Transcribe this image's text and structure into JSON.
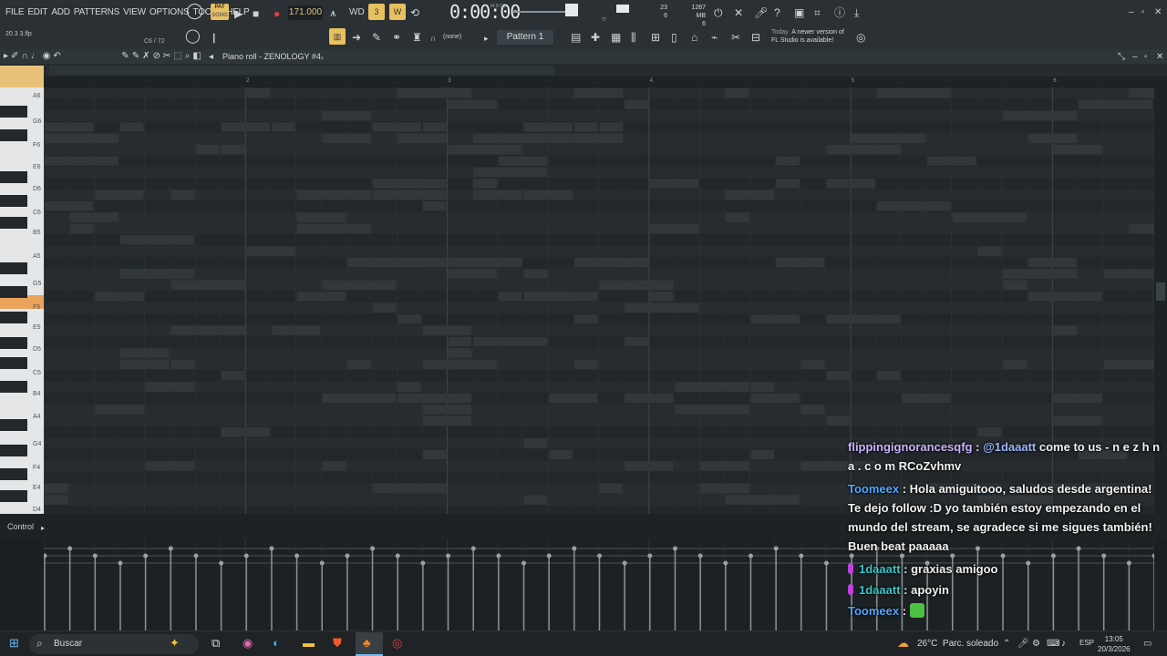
{
  "menu": [
    "FILE",
    "EDIT",
    "ADD",
    "PATTERNS",
    "VIEW",
    "OPTIONS",
    "TOOLS",
    "HELP"
  ],
  "transport": {
    "pat_song_top": "PAT",
    "pat_song_bottom": "SONG",
    "tempo": "171.000",
    "time": "0:00:00",
    "time_unit": "M:S:CS"
  },
  "resources": {
    "voices": "23",
    "voices2": "6",
    "memory": "1267 MB",
    "cpu": "6"
  },
  "project": {
    "name": "20.3 3.flp",
    "hint": "C6 / 72"
  },
  "toolbar2": {
    "snap": "(none)",
    "pattern": "Pattern 1",
    "news_today": "Today",
    "news_line1": "A newer version of",
    "news_line2": "FL Studio is available!"
  },
  "piano_roll": {
    "title": "Piano roll - ZENOLOGY #4",
    "bars": [
      "2",
      "3",
      "4",
      "5",
      "6"
    ],
    "keys": [
      "A6",
      "G6",
      "F6",
      "E6",
      "D6",
      "C6",
      "B5",
      "A5",
      "G5",
      "F5",
      "E5",
      "D5",
      "C5",
      "B4",
      "A4",
      "G4",
      "F4",
      "E4",
      "D4"
    ],
    "highlighted_key": "C6"
  },
  "control": {
    "label": "Control"
  },
  "chat": [
    {
      "user": "flippingignorancesqfg",
      "mention": "@1daaatt",
      "text": "come to us - n e z h n a . c o m RCoZvhmv"
    },
    {
      "user": "Toomeex",
      "text": "Hola amiguitooo, saludos desde argentina! Te dejo follow :D yo también estoy empezando en el mundo del stream, se agradece si me sigues también! Buen beat paaaaa"
    },
    {
      "user": "1daaatt",
      "text": "graxias amigoo"
    },
    {
      "user": "1daaatt",
      "text": "apoyin"
    },
    {
      "user": "Toomeex",
      "text": ""
    }
  ],
  "taskbar": {
    "search": "Buscar",
    "weather_temp": "26°C",
    "weather_desc": "Parc. soleado",
    "lang": "ESP",
    "time": "13:05",
    "date": "20/3/2026"
  }
}
